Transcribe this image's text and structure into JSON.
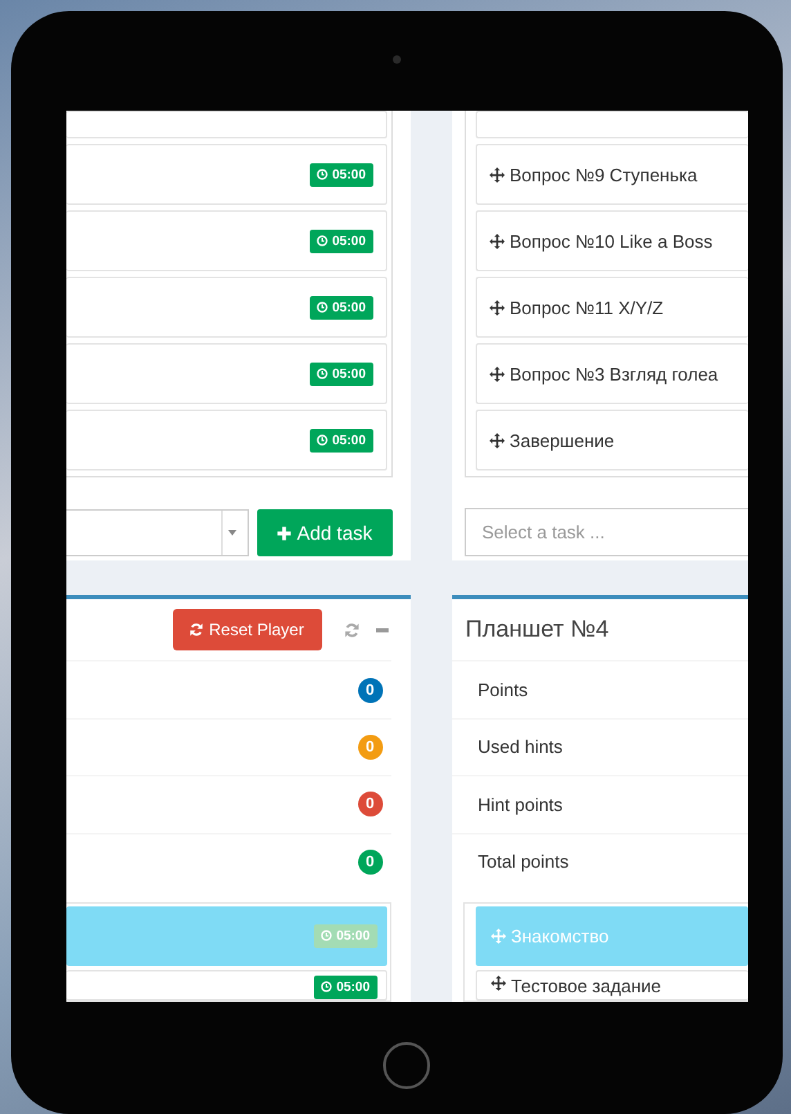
{
  "task_timeline": {
    "items": [
      {
        "timer": "05:00"
      },
      {
        "timer": "05:00"
      },
      {
        "timer": "05:00"
      },
      {
        "timer": "05:00"
      },
      {
        "timer": "05:00"
      }
    ],
    "add_button": "Add task"
  },
  "task_pool": {
    "items": [
      {
        "label": "Вопрос №9 Ступенька"
      },
      {
        "label": "Вопрос №10 Like a Boss"
      },
      {
        "label": "Вопрос №11 X/Y/Z"
      },
      {
        "label": "Вопрос №3 Взгляд голеа"
      },
      {
        "label": "Завершение"
      }
    ],
    "select_placeholder": "Select a task ..."
  },
  "player_panel": {
    "reset_button": "Reset Player",
    "badges": [
      {
        "value": "0",
        "color": "#0073b7"
      },
      {
        "value": "0",
        "color": "#f39c12"
      },
      {
        "value": "0",
        "color": "#dd4b39"
      },
      {
        "value": "0",
        "color": "#00a65a"
      }
    ],
    "tasks": [
      {
        "timer": "05:00",
        "selected": true
      },
      {
        "timer": "05:00",
        "selected": false
      }
    ]
  },
  "tablet_panel": {
    "title": "Планшет №4",
    "stats": [
      "Points",
      "Used hints",
      "Hint points",
      "Total points"
    ],
    "tasks": [
      {
        "label": "Знакомство",
        "selected": true
      },
      {
        "label": "Тестовое задание",
        "selected": false
      }
    ]
  }
}
